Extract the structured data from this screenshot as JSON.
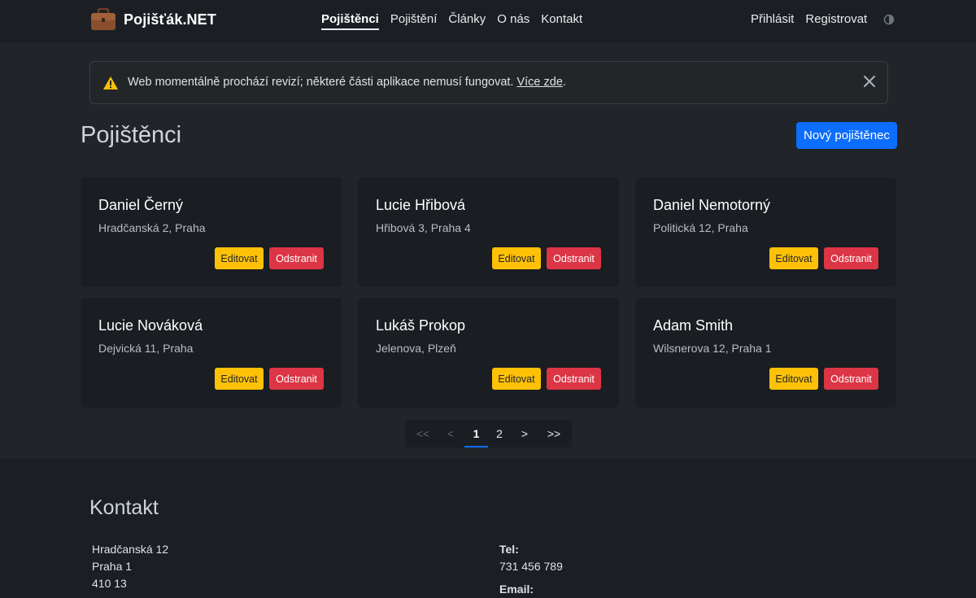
{
  "navbar": {
    "brand": "Pojišťák.NET",
    "links": [
      "Pojištěnci",
      "Pojištění",
      "Články",
      "O nás",
      "Kontakt"
    ],
    "active_link": "Pojištěnci",
    "login": "Přihlásit",
    "register": "Registrovat",
    "theme_icon": "contrast-icon"
  },
  "alert": {
    "text": "Web momentálně prochází revizí; některé části aplikace nemusí fungovat.",
    "link_text": "Více zde",
    "suffix": ".",
    "icon": "warning-icon",
    "close_icon": "close-icon"
  },
  "main": {
    "title": "Pojištěnci",
    "new_button": "Nový pojištěnec"
  },
  "cards": [
    {
      "name": "Daniel Černý",
      "address": "Hradčanská 2, Praha"
    },
    {
      "name": "Lucie Hřibová",
      "address": "Hřibová 3, Praha 4"
    },
    {
      "name": "Daniel Nemotorný",
      "address": "Politická 12, Praha"
    },
    {
      "name": "Lucie Nováková",
      "address": "Dejvická 11, Praha"
    },
    {
      "name": "Lukáš Prokop",
      "address": "Jelenova, Plzeň"
    },
    {
      "name": "Adam Smith",
      "address": "Wilsnerova 12, Praha 1"
    }
  ],
  "card_buttons": {
    "edit": "Editovat",
    "delete": "Odstranit"
  },
  "pagination": {
    "first": "<<",
    "prev": "<",
    "pages": [
      "1",
      "2"
    ],
    "current": "1",
    "next": ">",
    "last": ">>"
  },
  "footer": {
    "title": "Kontakt",
    "address": [
      "Hradčanská 12",
      "Praha 1",
      "410 13"
    ],
    "phone_label": "Tel:",
    "phone": "731 456 789",
    "email_label": "Email:"
  },
  "colors": {
    "background": "#212529",
    "navbar": "#1b1f23",
    "card": "#1a1d21",
    "primary": "#0d6efd",
    "warning": "#ffc107",
    "danger": "#dc3545"
  }
}
